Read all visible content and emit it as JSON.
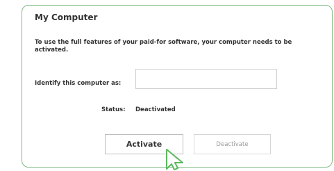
{
  "panel": {
    "title": "My Computer",
    "description": "To use the full features of your paid-for software, your computer needs to be activated."
  },
  "identify": {
    "label": "Identify this computer as:",
    "value": "",
    "placeholder": ""
  },
  "status": {
    "label": "Status:",
    "value": "Deactivated"
  },
  "buttons": {
    "activate_label": "Activate",
    "deactivate_label": "Deactivate"
  },
  "colors": {
    "panel_border": "#7dbb83",
    "cursor_stroke": "#5cb85c",
    "text": "#333333",
    "disabled_text": "#9a9a9a"
  },
  "icons": {
    "cursor": "pointer-cursor-icon"
  }
}
